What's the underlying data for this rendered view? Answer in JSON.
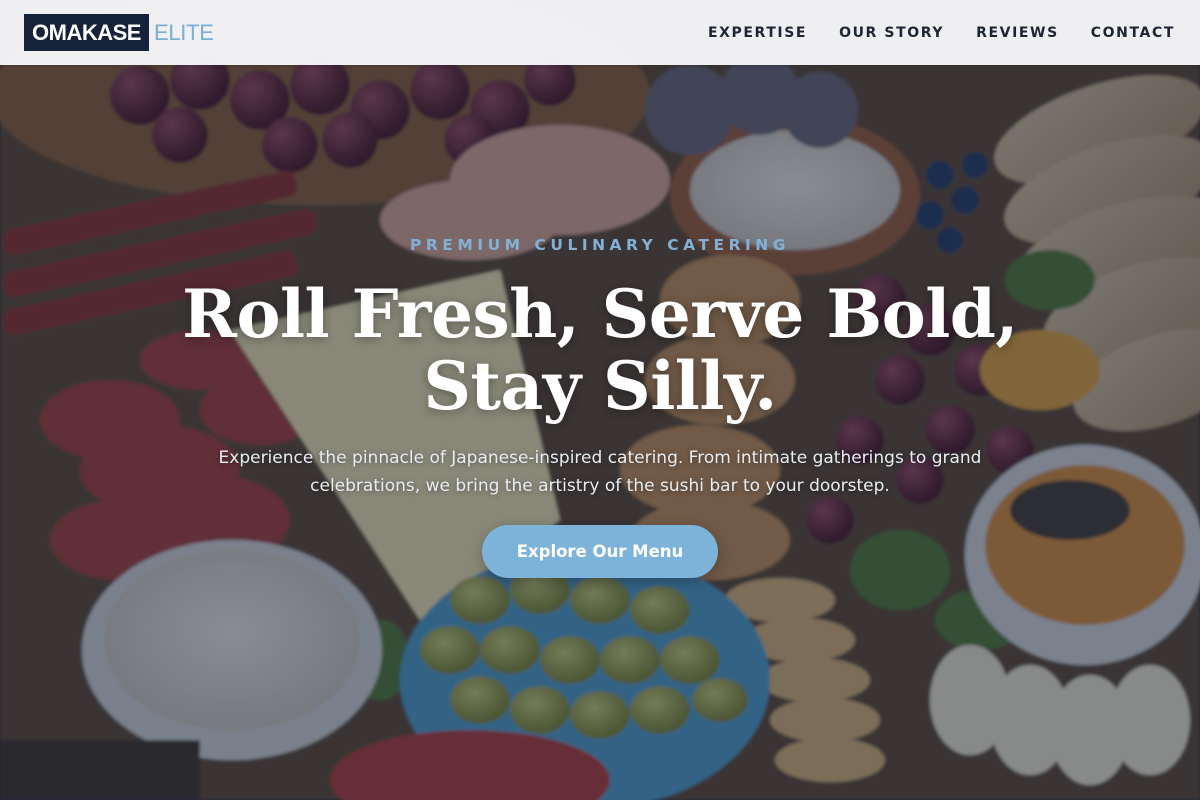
{
  "navbar": {
    "logo_primary": "OMAKASE",
    "logo_accent": "ELITE",
    "links": [
      {
        "label": "EXPERTISE"
      },
      {
        "label": "OUR STORY"
      },
      {
        "label": "REVIEWS"
      },
      {
        "label": "CONTACT"
      }
    ]
  },
  "hero": {
    "eyebrow": "PREMIUM CULINARY CATERING",
    "headline_line1": "Roll Fresh, Serve Bold,",
    "headline_line2": "Stay Silly.",
    "subtext_line1": "Experience the pinnacle of Japanese-inspired catering. From intimate gatherings to grand",
    "subtext_line2": "celebrations, we bring the artistry of the sushi bar to your doorstep.",
    "cta_label": "Explore Our Menu",
    "background_image": "charcuterie-board-photo"
  },
  "colors": {
    "logo_bg": "#16213a",
    "accent": "#7db2d9",
    "nav_text": "#1d2433",
    "overlay": "#182234"
  }
}
